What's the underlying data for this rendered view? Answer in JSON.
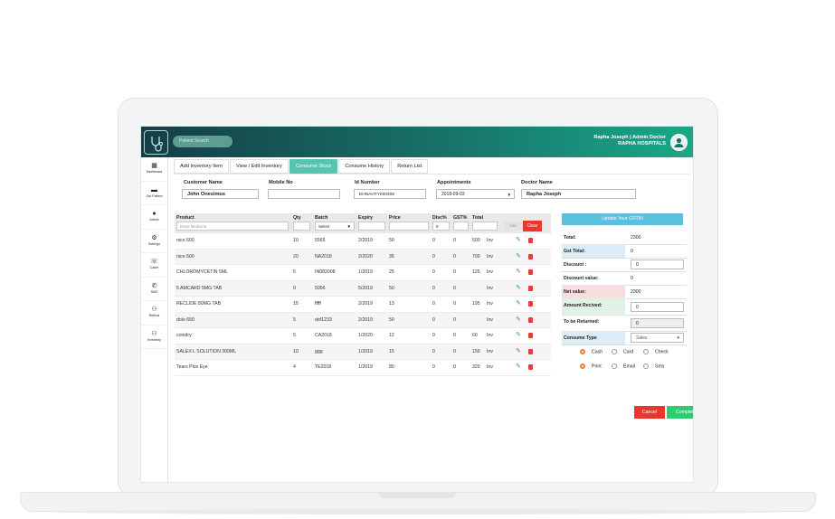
{
  "header": {
    "search_placeholder": "Patient Search",
    "user_name": "Rapha Joseph | Admin Doctor",
    "hospital": "RAPHA HOSPITALS"
  },
  "sidebar": {
    "items": [
      {
        "label": "Dashboard",
        "icon": "dashboard-icon"
      },
      {
        "label": "Out Patient",
        "icon": "bed-icon"
      },
      {
        "label": "Admin",
        "icon": "person-icon"
      },
      {
        "label": "Settings",
        "icon": "gear-icon"
      },
      {
        "label": "Caller",
        "icon": "caller-icon"
      },
      {
        "label": "SMS",
        "icon": "phone-icon"
      },
      {
        "label": "Referal",
        "icon": "group-icon"
      },
      {
        "label": "Inventory",
        "icon": "group-icon"
      }
    ]
  },
  "tabs": [
    "Add Inventory Item",
    "View / Edit Inventory",
    "Consume Stock",
    "Consume History",
    "Return List"
  ],
  "form": {
    "customer_name": {
      "label": "Customer Name",
      "value": "John Onesimus"
    },
    "mobile_no": {
      "label": "Mobile No",
      "value": ""
    },
    "id_number": {
      "label": "Id Number",
      "value": "EHNAHTY000309"
    },
    "appointments": {
      "label": "Appointments",
      "value": "2018-09-03"
    },
    "doctor_name": {
      "label": "Doctor Name",
      "value": "Rapha Joseph"
    }
  },
  "table": {
    "headers": {
      "product": "Product",
      "qty": "Qty",
      "batch": "Batch",
      "expiry": "Expiry",
      "price": "Price",
      "disc": "Disc%",
      "gst": "GST%",
      "total": "Total"
    },
    "product_placeholder": "Enter Medicine",
    "batch_select": "Select",
    "disc_default": "0",
    "add_label": "Add",
    "clear_label": "Clear",
    "rows": [
      {
        "product": "nice 600",
        "qty": "10",
        "batch": "5565",
        "expiry": "2/2019",
        "price": "50",
        "disc": "0",
        "gst": "0",
        "total": "500",
        "inv": "Inv"
      },
      {
        "product": "nice 600",
        "qty": "20",
        "batch": "NA2018",
        "expiry": "2/2020",
        "price": "35",
        "disc": "0",
        "gst": "0",
        "total": "700",
        "inv": "Inv"
      },
      {
        "product": "CHLOROMYCETIN 5ML",
        "qty": "5",
        "batch": "IN082008",
        "expiry": "1/2019",
        "price": "25",
        "disc": "0",
        "gst": "0",
        "total": "125",
        "inv": "Inv"
      },
      {
        "product": "5 AMCARD 5MG TAB",
        "qty": "0",
        "batch": "5056",
        "expiry": "5/2019",
        "price": "50",
        "disc": "0",
        "gst": "0",
        "total": "",
        "inv": "Inv"
      },
      {
        "product": "RECLIDE 80MG TAB",
        "qty": "15",
        "batch": "fffff",
        "expiry": "2/2019",
        "price": "13",
        "disc": "0",
        "gst": "0",
        "total": "195",
        "inv": "Inv"
      },
      {
        "product": "dolo 650",
        "qty": "5",
        "batch": "def1233",
        "expiry": "2/2019",
        "price": "50",
        "disc": "0",
        "gst": "0",
        "total": "",
        "inv": "Inv"
      },
      {
        "product": "coindry",
        "qty": "5",
        "batch": "CA2018",
        "expiry": "1/2020",
        "price": "12",
        "disc": "0",
        "gst": "0",
        "total": "60",
        "inv": "Inv"
      },
      {
        "product": "SALEX L SOLUTION 300ML",
        "qty": "10",
        "batch": "ggg",
        "expiry": "1/2019",
        "price": "15",
        "disc": "0",
        "gst": "0",
        "total": "150",
        "inv": "Inv"
      },
      {
        "product": "Tears Plus Eye",
        "qty": "4",
        "batch": "TE2018",
        "expiry": "1/2019",
        "price": "80",
        "disc": "0",
        "gst": "0",
        "total": "320",
        "inv": "Inv"
      }
    ]
  },
  "summary": {
    "gst_button": "Update Your GSTIN",
    "total_label": "Total:",
    "total_value": "2300",
    "gst_total_label": "Gst Total:",
    "gst_total_value": "0",
    "discount_label": "Discount :",
    "discount_value": "0",
    "discount_value_label": "Discount value:",
    "discount_value_value": "0",
    "net_value_label": "Net value:",
    "net_value_value": "2300",
    "amount_received_label": "Amount Recived:",
    "amount_received_value": "0",
    "to_be_returned_label": "To be Returned:",
    "to_be_returned_value": "0",
    "consume_type_label": "Consume Type",
    "consume_type_value": "Sales",
    "payment_options": [
      "Cash",
      "Card",
      "Check"
    ],
    "output_options": [
      "Print",
      "Email",
      "Sms"
    ]
  },
  "actions": {
    "cancel": "Cancel",
    "complete": "Complete Sale"
  },
  "colors": {
    "accent": "#57c4ad",
    "danger": "#e8372d",
    "success": "#2ecc71",
    "info": "#5bc0de"
  }
}
